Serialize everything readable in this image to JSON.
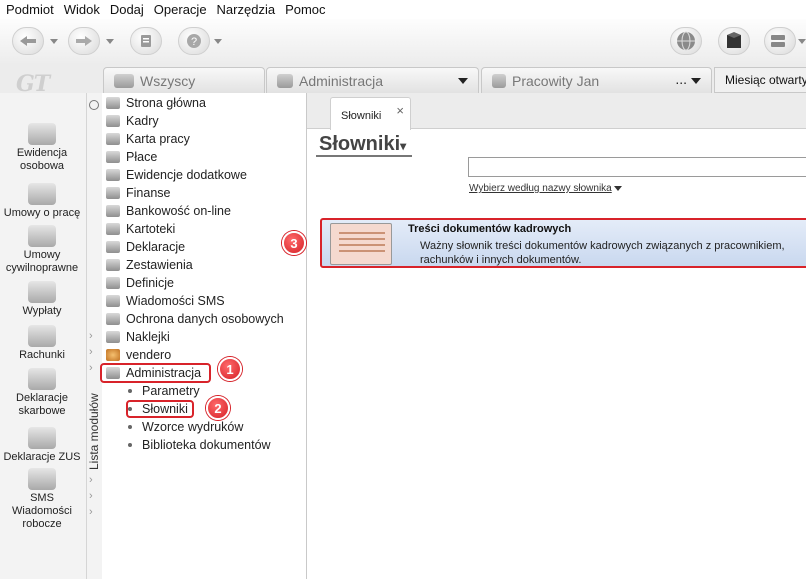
{
  "menu": [
    "Podmiot",
    "Widok",
    "Dodaj",
    "Operacje",
    "Narzędzia",
    "Pomoc"
  ],
  "toolbar": {
    "left_buttons": [
      "back-nav-icon",
      "forward-nav-icon",
      "docs-icon",
      "help-icon"
    ],
    "right_buttons": [
      "globe-icon",
      "box-icon",
      "server-icon"
    ]
  },
  "logo_text": "GT",
  "tabs": [
    {
      "label": "Wszyscy"
    },
    {
      "label": "Administracja"
    },
    {
      "label": "Pracowity Jan",
      "more": "..."
    }
  ],
  "month_label": "Miesiąc otwarty:",
  "left_panel": [
    {
      "label": "Ewidencja osobowa",
      "icon": "person-icon"
    },
    {
      "label": "Umowy o pracę",
      "icon": "contract-icon"
    },
    {
      "label": "Umowy cywilnoprawne",
      "icon": "contract-civil-icon"
    },
    {
      "label": "Wypłaty",
      "icon": "payout-icon"
    },
    {
      "label": "Rachunki",
      "icon": "bill-icon"
    },
    {
      "label": "Deklaracje skarbowe",
      "icon": "tax-declaration-icon"
    },
    {
      "label": "Deklaracje ZUS",
      "icon": "zus-icon"
    },
    {
      "label": "SMS Wiadomości robocze",
      "icon": "sms-icon"
    }
  ],
  "module_list_label": "Lista modułów",
  "modules": [
    "Strona główna",
    "Kadry",
    "Karta pracy",
    "Płace",
    "Ewidencje dodatkowe",
    "Finanse",
    "Bankowość on-line",
    "Kartoteki",
    "Deklaracje",
    "Zestawienia",
    "Definicje",
    "Wiadomości SMS",
    "Ochrona danych osobowych",
    "Naklejki",
    "vendero",
    "Administracja"
  ],
  "submodules": [
    "Parametry",
    "Słowniki",
    "Wzorce wydruków",
    "Biblioteka dokumentów"
  ],
  "badges": [
    "1",
    "2",
    "3"
  ],
  "doc_tab": {
    "label": "Słowniki",
    "close": "×"
  },
  "page_title": "Słowniki",
  "search": {
    "value": "",
    "mode_label": "Wybierz według nazwy słownika"
  },
  "dictionary_item": {
    "title": "Treści dokumentów kadrowych",
    "description_line1": "Ważny słownik treści dokumentów kadrowych związanych z pracownikiem,",
    "description_line2": "rachunków i innych dokumentów."
  },
  "colors": {
    "highlight": "#d8232a",
    "selected_bg": "#c9d8ef"
  }
}
